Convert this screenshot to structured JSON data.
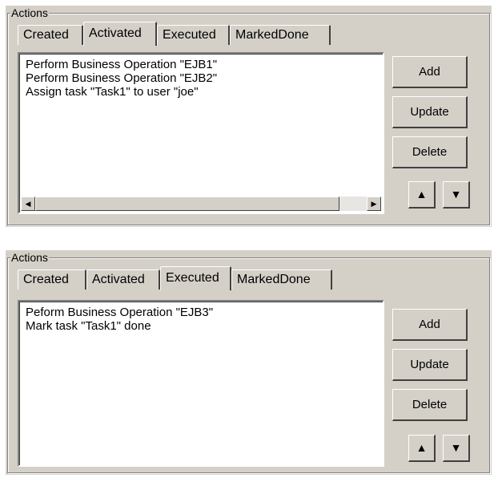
{
  "panels": [
    {
      "title": "Actions",
      "tabs": [
        "Created",
        "Activated",
        "Executed",
        "MarkedDone"
      ],
      "active_tab": "Activated",
      "items": [
        "Perform Business Operation \"EJB1\"",
        "Perform Business Operation \"EJB2\"",
        "Assign task \"Task1\" to user \"joe\""
      ],
      "buttons": {
        "add": "Add",
        "update": "Update",
        "delete": "Delete"
      },
      "icons": {
        "scroll_left": "scroll-left-icon",
        "scroll_right": "scroll-right-icon",
        "move_up": "arrow-up-icon",
        "move_down": "arrow-down-icon"
      }
    },
    {
      "title": "Actions",
      "tabs": [
        "Created",
        "Activated",
        "Executed",
        "MarkedDone"
      ],
      "active_tab": "Executed",
      "items": [
        "Peform Business Operation \"EJB3\"",
        "Mark task \"Task1\" done"
      ],
      "buttons": {
        "add": "Add",
        "update": "Update",
        "delete": "Delete"
      },
      "icons": {
        "move_up": "arrow-up-icon",
        "move_down": "arrow-down-icon"
      }
    }
  ],
  "colors": {
    "face": "#d4d0c8",
    "shadow": "#808080",
    "dark_shadow": "#404040",
    "highlight": "#ffffff",
    "list_bg": "#ffffff"
  }
}
